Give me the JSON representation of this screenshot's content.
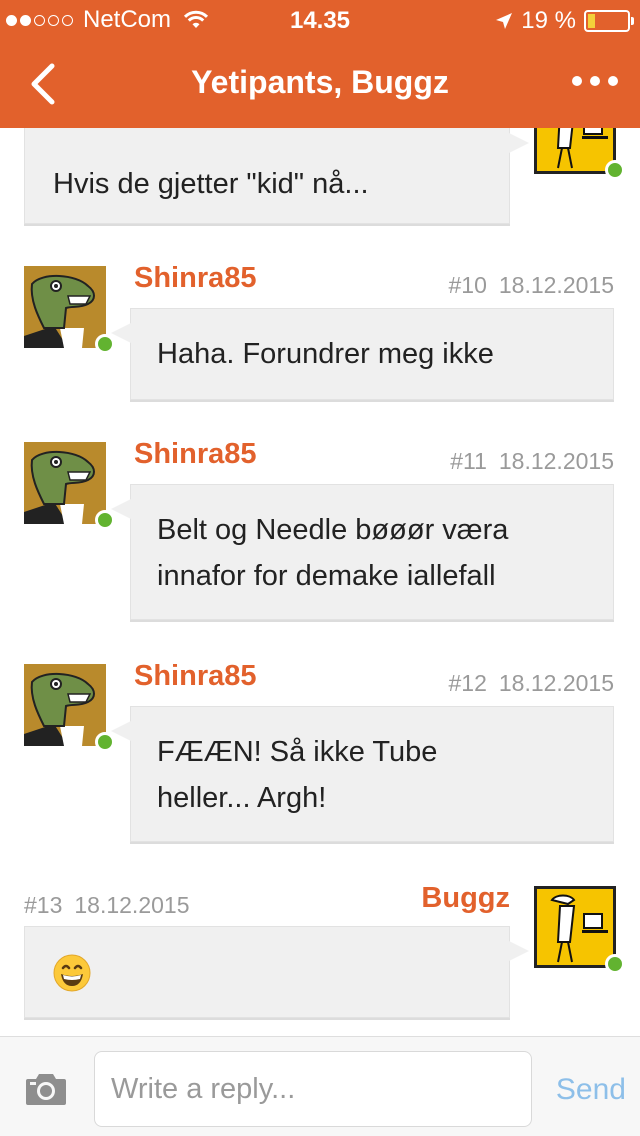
{
  "status_bar": {
    "signal_bars_filled": 2,
    "signal_bars_total": 5,
    "carrier": "NetCom",
    "time": "14.35",
    "battery_text": "19 %",
    "battery_level": 0.19,
    "icons": [
      "wifi-icon",
      "location-arrow-icon",
      "battery-icon"
    ]
  },
  "nav": {
    "back_icon": "chevron-left-icon",
    "title": "Yetipants, Buggz",
    "more_icon": "ellipsis-icon"
  },
  "messages": [
    {
      "side": "right",
      "author": "",
      "number": "",
      "date": "",
      "text_lines": [
        "Hvis de gjetter \"kid\" nå..."
      ],
      "avatar": "buggz-avatar"
    },
    {
      "side": "left",
      "author": "Shinra85",
      "number": "#10",
      "date": "18.12.2015",
      "text_lines": [
        "Haha. Forundrer meg ikke"
      ],
      "avatar": "shinra-avatar"
    },
    {
      "side": "left",
      "author": "Shinra85",
      "number": "#11",
      "date": "18.12.2015",
      "text_lines": [
        "Belt og Needle bøøør væra",
        "innafor for demake iallefall"
      ],
      "avatar": "shinra-avatar"
    },
    {
      "side": "left",
      "author": "Shinra85",
      "number": "#12",
      "date": "18.12.2015",
      "text_lines": [
        "FÆÆN! Så ikke Tube",
        "heller... Argh!"
      ],
      "avatar": "shinra-avatar"
    },
    {
      "side": "right",
      "author": "Buggz",
      "number": "#13",
      "date": "18.12.2015",
      "text_lines": [],
      "emoji": "grinning-face-emoji",
      "avatar": "buggz-avatar"
    }
  ],
  "reply_bar": {
    "camera_icon": "camera-icon",
    "placeholder": "Write a reply...",
    "send_label": "Send"
  },
  "colors": {
    "brand": "#e2612c",
    "online": "#62b330",
    "send_disabled": "#8dbfe9"
  }
}
